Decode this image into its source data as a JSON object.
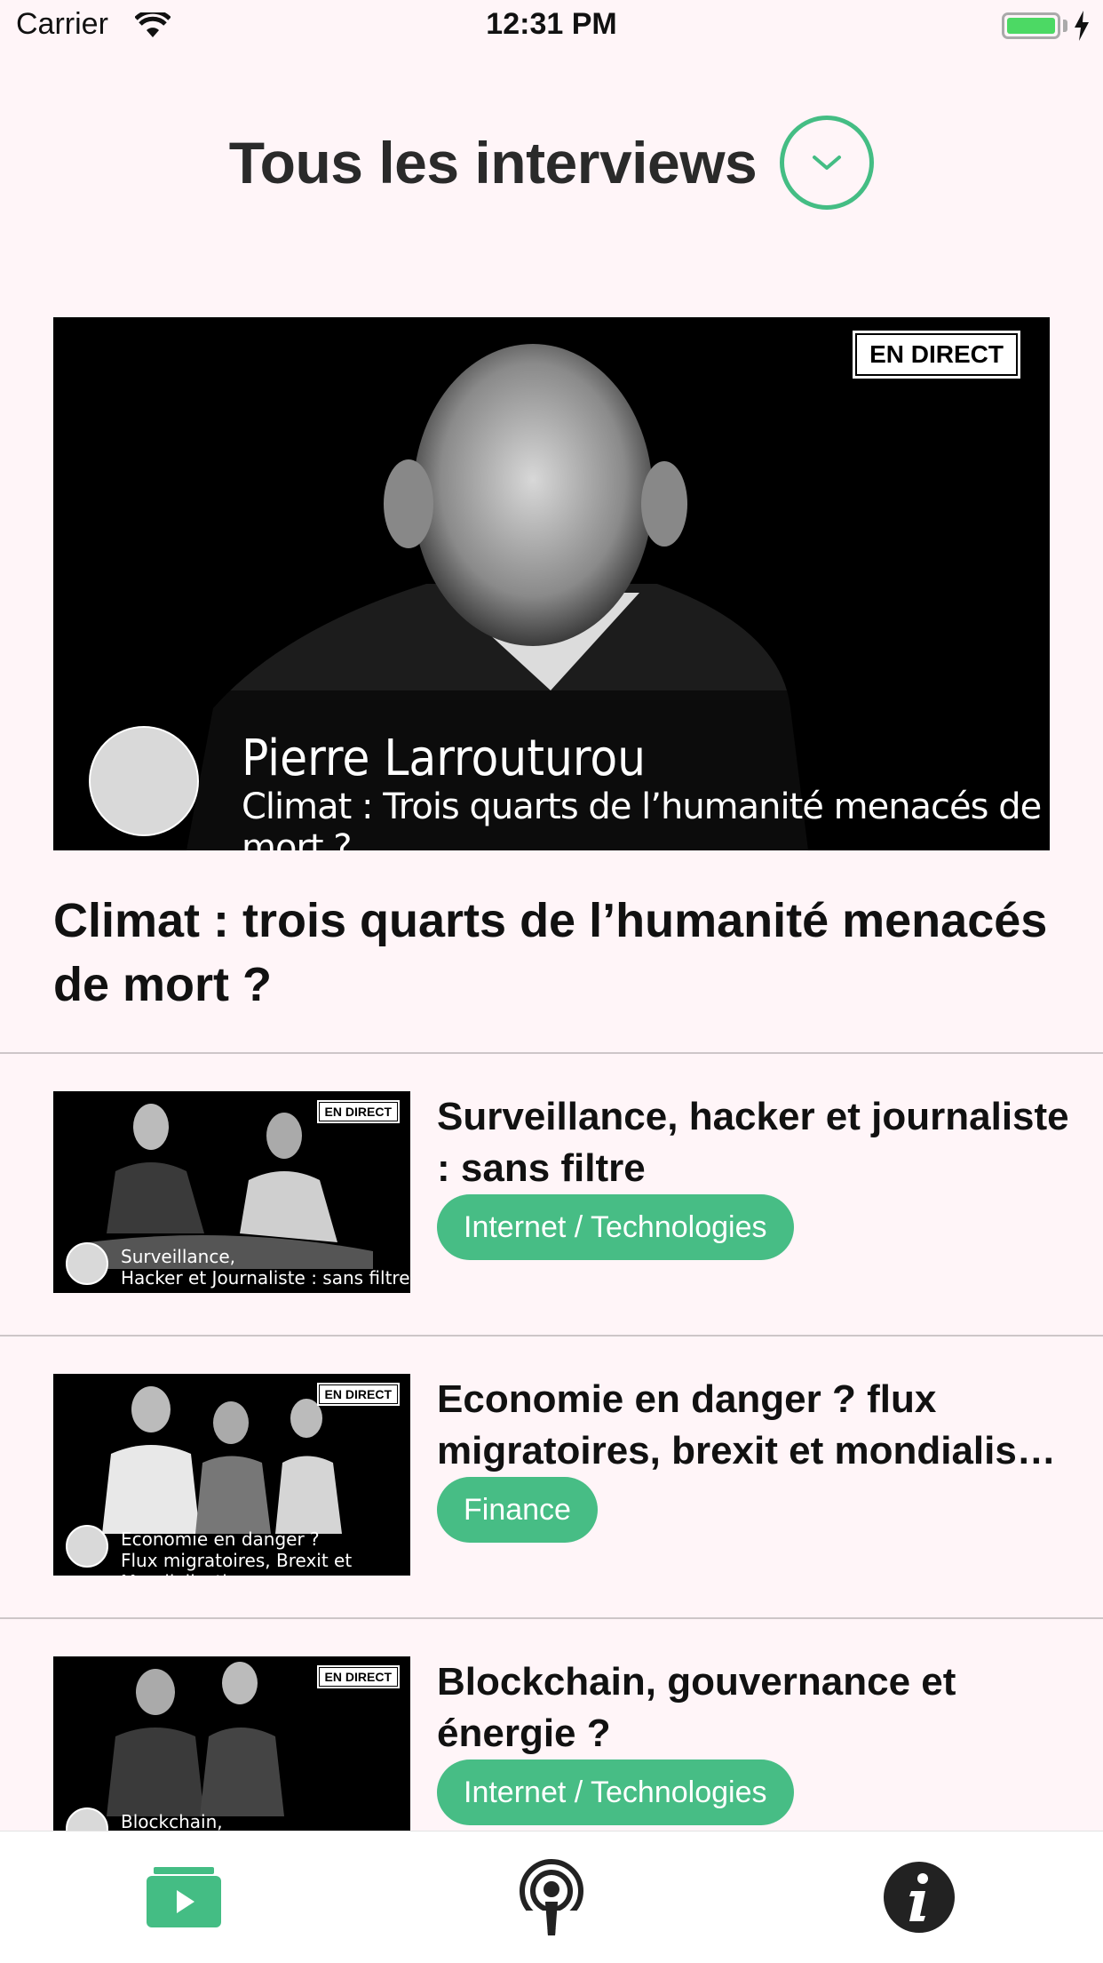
{
  "status_bar": {
    "carrier": "Carrier",
    "time": "12:31 PM"
  },
  "header": {
    "title": "Tous les interviews"
  },
  "featured": {
    "badge": "EN DIRECT",
    "thumb_name": "Pierre Larrouturou",
    "thumb_subtitle": "Climat : Trois quarts de l’humanité menacés de mort ?",
    "title": "Climat : trois quarts de l’humanité menacés de mort ?"
  },
  "interviews": [
    {
      "badge": "EN DIRECT",
      "caption_line1": "Surveillance,",
      "caption_line2": "Hacker et Journaliste : sans filtre",
      "title": "Surveillance, hacker et journaliste : sans filtre",
      "tag": "Internet / Technologies"
    },
    {
      "badge": "EN DIRECT",
      "caption_line1": "Economie en danger ?",
      "caption_line2": "Flux migratoires, Brexit et Mondialisation",
      "title": "Economie en danger ? flux migratoires, brexit et mondialis…",
      "tag": "Finance"
    },
    {
      "badge": "EN DIRECT",
      "caption_line1": "Blockchain,",
      "caption_line2": "",
      "title": "Blockchain, gouvernance et énergie ?",
      "tag": "Internet / Technologies"
    }
  ],
  "tab_bar": {
    "tabs": [
      {
        "icon": "video-folder-icon",
        "active": true
      },
      {
        "icon": "podcast-icon",
        "active": false
      },
      {
        "icon": "info-icon",
        "active": false
      }
    ]
  },
  "colors": {
    "accent": "#44bd84",
    "background": "#fff5f8",
    "text": "#111111"
  }
}
